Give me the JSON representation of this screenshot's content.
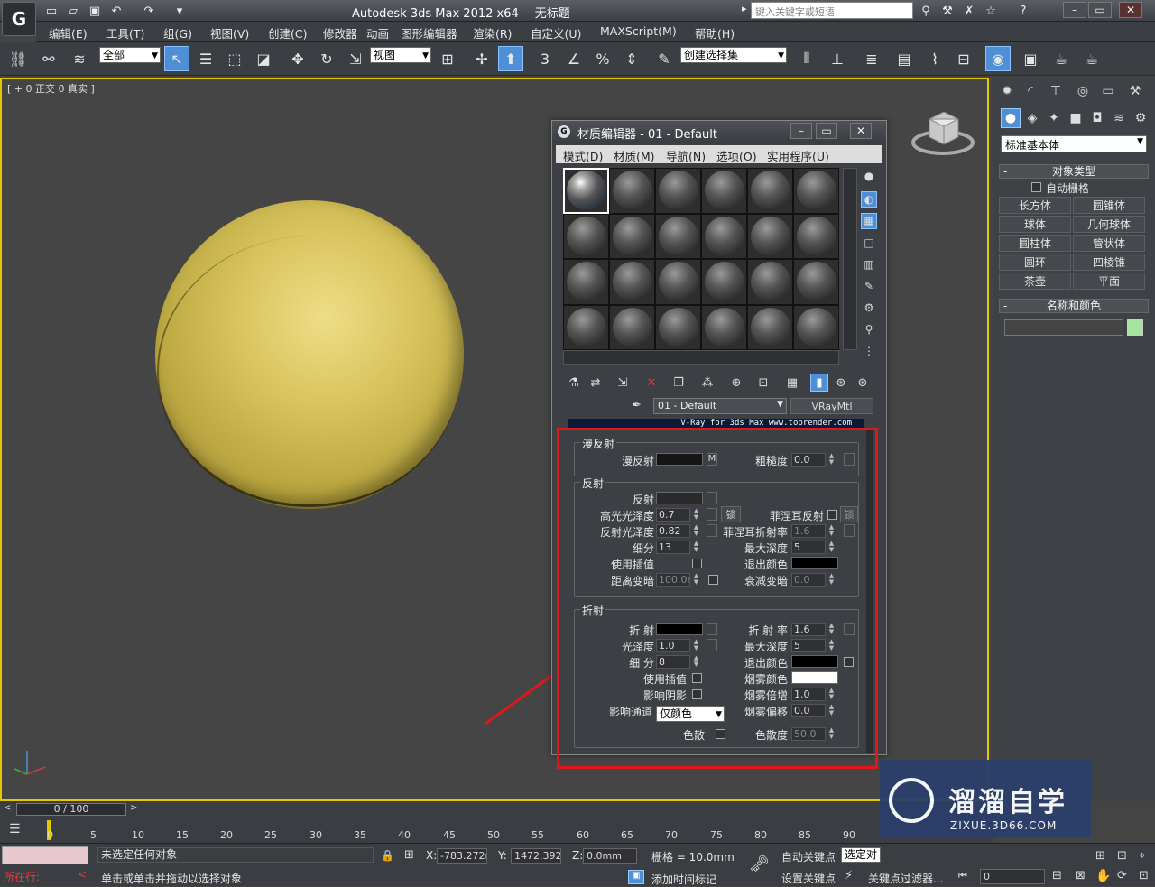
{
  "app": {
    "title": "Autodesk 3ds Max  2012 x64",
    "doc": "无标题",
    "search_placeholder": "键入关键字或短语"
  },
  "menu": [
    "编辑(E)",
    "工具(T)",
    "组(G)",
    "视图(V)",
    "创建(C)",
    "修改器",
    "动画",
    "图形编辑器",
    "渲染(R)",
    "自定义(U)",
    "MAXScript(M)",
    "帮助(H)"
  ],
  "toolbar": {
    "filter_value": "全部",
    "refcoord_value": "视图",
    "selection_set_placeholder": "创建选择集"
  },
  "viewport": {
    "label": "[ + 0 正交 0 真实 ]",
    "active_border_color": "#e3c700",
    "sphere_color": "#d8c45c"
  },
  "command_panel": {
    "category": "标准基本体",
    "object_type_title": "对象类型",
    "autogrid": "自动栅格",
    "buttons": [
      "长方体",
      "圆锥体",
      "球体",
      "几何球体",
      "圆柱体",
      "管状体",
      "圆环",
      "四棱锥",
      "茶壶",
      "平面"
    ],
    "name_color_title": "名称和颜色",
    "object_color": "#a6e3a0"
  },
  "material_editor": {
    "title": "材质编辑器 - 01 - Default",
    "menu": [
      "模式(D)",
      "材质(M)",
      "导航(N)",
      "选项(O)",
      "实用程序(U)"
    ],
    "material_name": "01 - Default",
    "material_type": "VRayMtl",
    "banner_text": "V-Ray for 3ds Max  www.toprender.com",
    "diffuse": {
      "title": "漫反射",
      "label": "漫反射",
      "map_button": "M",
      "roughness_label": "粗糙度",
      "roughness": "0.0"
    },
    "reflection": {
      "title": "反射",
      "reflect_label": "反射",
      "hilight_gloss_label": "高光光泽度",
      "hilight_gloss": "0.7",
      "lock_label": "锁",
      "refl_gloss_label": "反射光泽度",
      "refl_gloss": "0.82",
      "subdivs_label": "细分",
      "subdivs": "13",
      "use_interp_label": "使用插值",
      "dim_distance_label": "距离变暗",
      "dim_distance": "100.0m",
      "fresnel_label": "菲涅耳反射",
      "fresnel_lock": "锁",
      "fresnel_ior_label": "菲涅耳折射率",
      "fresnel_ior": "1.6",
      "max_depth_label": "最大深度",
      "max_depth": "5",
      "exit_color_label": "退出颜色",
      "dim_falloff_label": "衰减变暗",
      "dim_falloff": "0.0"
    },
    "refraction": {
      "title": "折射",
      "refract_label": "折 射",
      "gloss_label": "光泽度",
      "gloss": "1.0",
      "subdivs_label": "细 分",
      "subdivs": "8",
      "use_interp_label": "使用插值",
      "affect_shadows_label": "影响阴影",
      "affect_channels_label": "影响通道",
      "affect_channels": "仅颜色",
      "dispersion_label": "色散",
      "ior_label": "折 射 率",
      "ior": "1.6",
      "max_depth_label": "最大深度",
      "max_depth": "5",
      "exit_color_label": "退出颜色",
      "fog_color_label": "烟雾颜色",
      "fog_mult_label": "烟雾倍增",
      "fog_mult": "1.0",
      "fog_bias_label": "烟雾偏移",
      "fog_bias": "0.0",
      "abbe_label": "色散度",
      "abbe": "50.0"
    }
  },
  "timeline": {
    "slider": "0 / 100",
    "ticks": [
      "0",
      "5",
      "10",
      "15",
      "20",
      "25",
      "30",
      "35",
      "40",
      "45",
      "50",
      "55",
      "60",
      "65",
      "70",
      "75",
      "80",
      "85",
      "90"
    ]
  },
  "status": {
    "selection": "未选定任何对象",
    "prompt": "单击或单击并拖动以选择对象",
    "running": "所在行:",
    "x_label": "X:",
    "x": "-783.272m",
    "y_label": "Y:",
    "y": "1472.392m",
    "z_label": "Z:",
    "z": "0.0mm",
    "grid": "栅格 = 10.0mm",
    "autokey": "自动关键点",
    "selected": "选定对",
    "setkey": "设置关键点",
    "key_filters": "关键点过滤器...",
    "add_time_tag": "添加时间标记",
    "frame": "0"
  },
  "watermark": {
    "text": "溜溜自学",
    "sub": "ZIXUE.3D66.COM"
  }
}
